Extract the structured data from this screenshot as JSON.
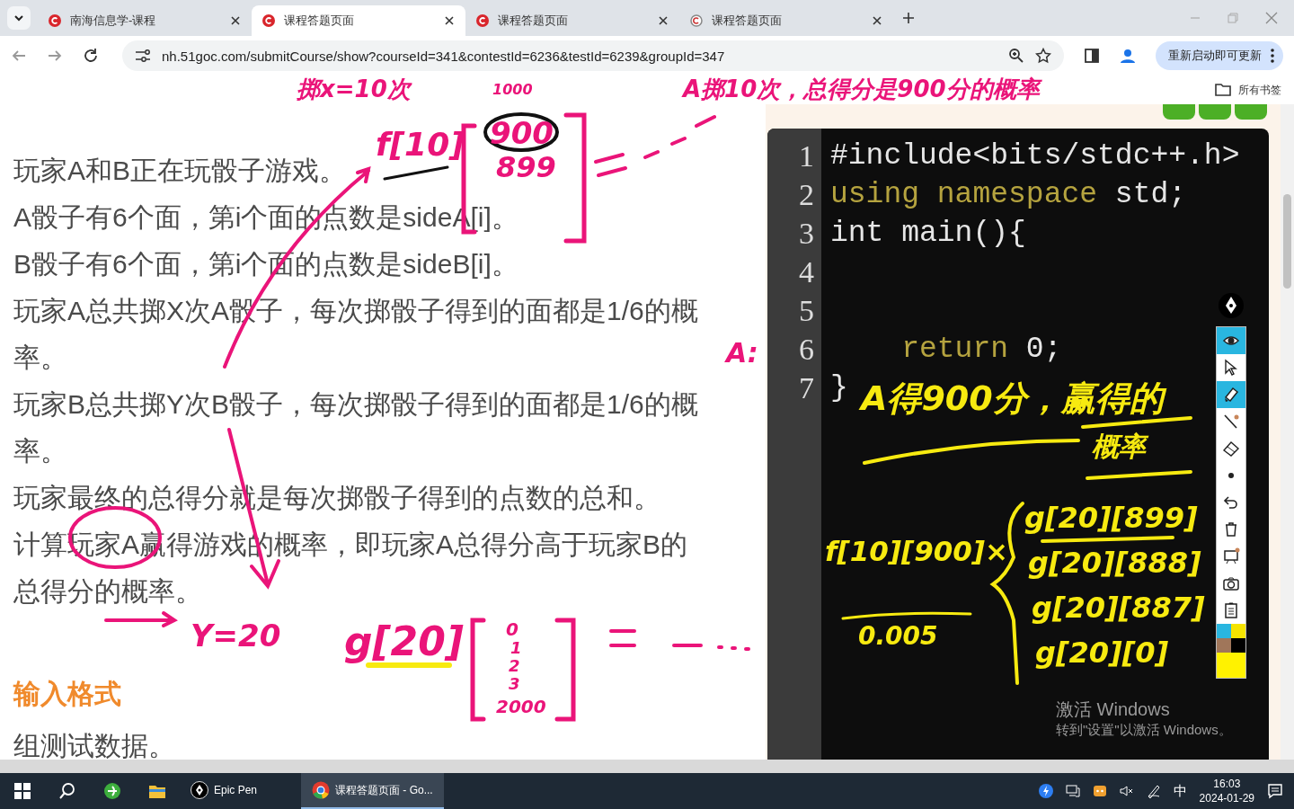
{
  "browser": {
    "tabs": [
      {
        "title": "南海信息学-课程",
        "selected": false,
        "faded": false
      },
      {
        "title": "课程答题页面",
        "selected": true,
        "faded": false
      },
      {
        "title": "课程答题页面",
        "selected": false,
        "faded": false
      },
      {
        "title": "课程答题页面",
        "selected": false,
        "faded": true
      }
    ],
    "url": "nh.51goc.com/submitCourse/show?courseId=341&contestId=6236&testId=6239&groupId=347",
    "update_button": "重新启动即可更新",
    "bookmarks_folder": "所有书签"
  },
  "problem": {
    "paragraphs": [
      "玩家A和B正在玩骰子游戏。",
      "A骰子有6个面，第i个面的点数是sideA[i]。",
      "B骰子有6个面，第i个面的点数是sideB[i]。",
      "玩家A总共掷X次A骰子，每次掷骰子得到的面都是1/6的概率。",
      "玩家B总共掷Y次B骰子，每次掷骰子得到的面都是1/6的概率。",
      "玩家最终的总得分就是每次掷骰子得到的点数的总和。",
      "计算玩家A赢得游戏的概率，即玩家A总得分高于玩家B的总得分的概率。"
    ],
    "section_heading": "输入格式",
    "section_text": "组测试数据。"
  },
  "editor": {
    "lines": [
      {
        "number": "1",
        "tokens": [
          {
            "text": "#include<bits/stdc++.h>",
            "kind": "plain"
          }
        ]
      },
      {
        "number": "2",
        "tokens": [
          {
            "text": "using namespace",
            "kind": "keyword"
          },
          {
            "text": " std;",
            "kind": "plain"
          }
        ]
      },
      {
        "number": "3",
        "tokens": [
          {
            "text": "int main(){",
            "kind": "plain"
          }
        ]
      },
      {
        "number": "4"
      },
      {
        "number": "5"
      },
      {
        "number": "6",
        "tokens": [
          {
            "text": "    return",
            "kind": "keyword"
          },
          {
            "text": " 0;",
            "kind": "plain"
          }
        ]
      },
      {
        "number": "7",
        "tokens": [
          {
            "text": "}",
            "kind": "plain"
          }
        ]
      }
    ]
  },
  "pen_toolbar": {
    "tools": [
      {
        "selected": true
      },
      {
        "selected": false
      },
      {
        "selected": true
      },
      {
        "selected": false
      },
      {
        "selected": false
      },
      {
        "selected": false
      },
      {
        "selected": false
      },
      {
        "selected": false
      },
      {
        "selected": false
      },
      {
        "selected": false
      },
      {
        "selected": false
      }
    ],
    "palette": [
      {
        "color": "#29b6e0"
      },
      {
        "color": "#f5e400"
      },
      {
        "color": "#a0765a"
      },
      {
        "color": "#000000"
      },
      {
        "color": "#fff200"
      }
    ]
  },
  "annotations": [
    {
      "text": "掷x=10次",
      "color": "#ea1479"
    },
    {
      "text": "1000",
      "color": "#ea1479"
    },
    {
      "text": "A掷10次，总得分是900分的概率",
      "color": "#ea1479"
    },
    {
      "text": "f[10]",
      "color": "#ea1479"
    },
    {
      "text": "900",
      "color": "#ea1479"
    },
    {
      "text": "899",
      "color": "#ea1479"
    },
    {
      "text": "A:",
      "color": "#ea1479"
    },
    {
      "text": "Y=20",
      "color": "#ea1479"
    },
    {
      "text": "g[20]",
      "color": "#ea1479"
    },
    {
      "text": "0",
      "color": "#ea1479"
    },
    {
      "text": "1",
      "color": "#ea1479"
    },
    {
      "text": "2",
      "color": "#ea1479"
    },
    {
      "text": "3",
      "color": "#ea1479"
    },
    {
      "text": "2000",
      "color": "#ea1479"
    },
    {
      "text": "A得900分，赢得的",
      "color": "#f7ea10"
    },
    {
      "text": "概率",
      "color": "#f7ea10"
    },
    {
      "text": "f[10][900]×",
      "color": "#f7ea10"
    },
    {
      "text": "0.005",
      "color": "#f7ea10"
    },
    {
      "text": "g[20][899]",
      "color": "#f7ea10"
    },
    {
      "text": "g[20][888]",
      "color": "#f7ea10"
    },
    {
      "text": "g[20][887]",
      "color": "#f7ea10"
    },
    {
      "text": "g[20][0]",
      "color": "#f7ea10"
    }
  ],
  "system": {
    "watermark_title": "激活 Windows",
    "watermark_text": "转到\"设置\"以激活 Windows。"
  },
  "taskbar": {
    "apps": [
      {
        "label": "Epic Pen",
        "selected": false
      },
      {
        "label": "课程答题页面 - Go...",
        "selected": true
      }
    ],
    "input_method": "中",
    "time": "16:03",
    "date": "2024-01-29"
  }
}
